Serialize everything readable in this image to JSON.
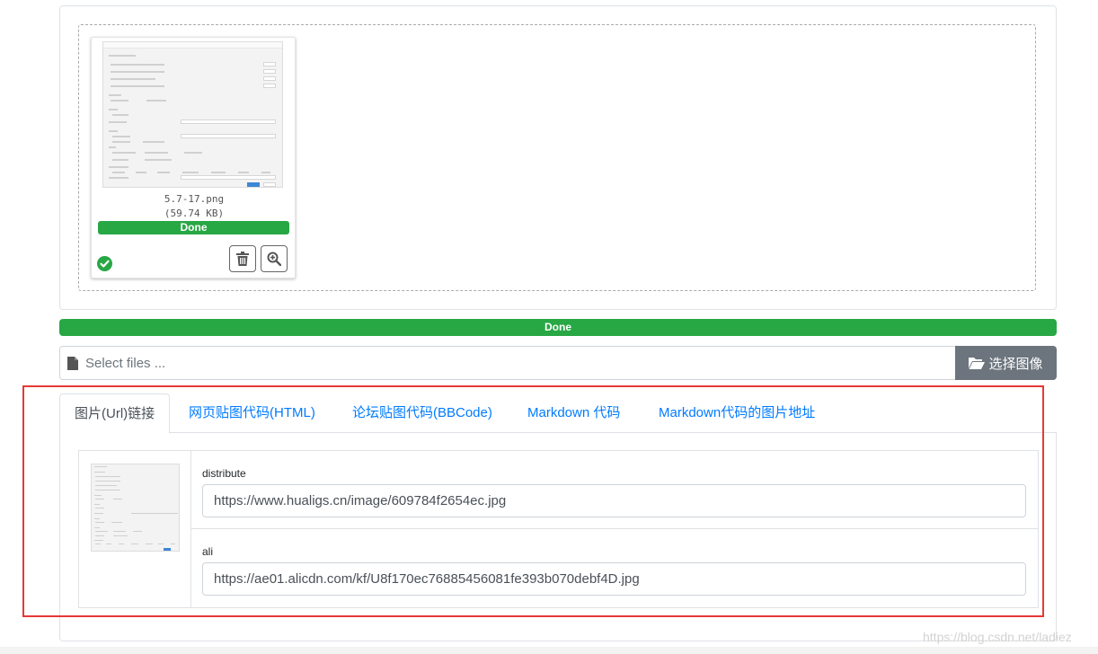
{
  "upload": {
    "file_name": "5.7-17.png",
    "file_size": "(59.74 KB)",
    "file_status": "Done",
    "delete_icon": "trash-icon",
    "zoom_icon": "zoom-in-icon",
    "success_icon": "check-circle-icon"
  },
  "main_progress": {
    "label": "Done",
    "percent": 100,
    "color": "#28a745"
  },
  "file_input": {
    "placeholder": "Select files ...",
    "browse_label": "选择图像",
    "browse_icon": "folder-open-icon",
    "file_icon": "file-icon"
  },
  "tabs": [
    {
      "label": "图片(Url)链接",
      "active": true
    },
    {
      "label": "网页贴图代码(HTML)",
      "active": false
    },
    {
      "label": "论坛贴图代码(BBCode)",
      "active": false
    },
    {
      "label": "Markdown 代码",
      "active": false
    },
    {
      "label": "Markdown代码的图片地址",
      "active": false
    }
  ],
  "links": [
    {
      "label": "distribute",
      "value": "https://www.hualigs.cn/image/609784f2654ec.jpg"
    },
    {
      "label": "ali",
      "value": "https://ae01.alicdn.com/kf/U8f170ec76885456081fe393b070debf4D.jpg"
    }
  ],
  "watermark": "https://blog.csdn.net/ladiez",
  "colors": {
    "success": "#28a745",
    "link": "#007bff",
    "secondary": "#6c757d",
    "highlight": "#e53935"
  }
}
